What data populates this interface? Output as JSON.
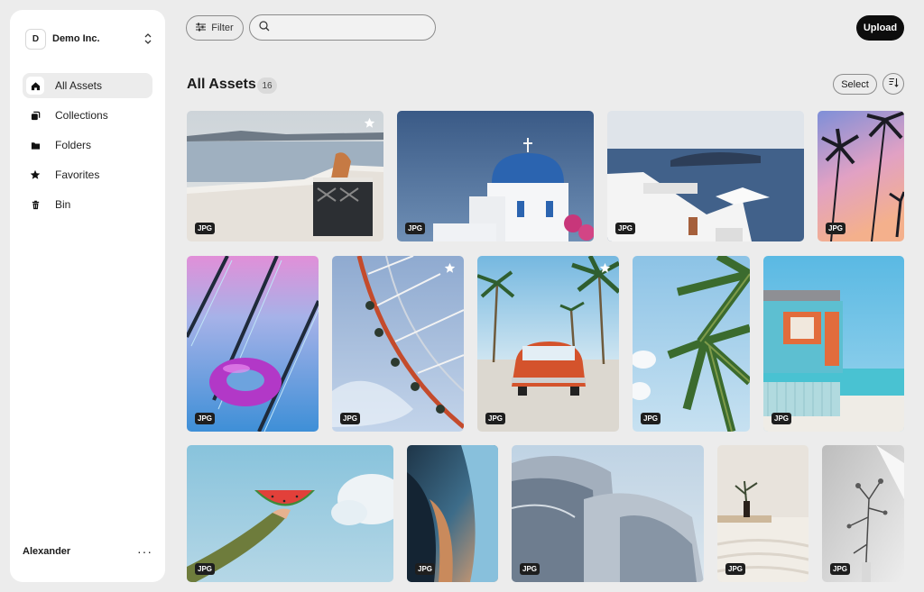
{
  "org": {
    "initial": "D",
    "name": "Demo Inc."
  },
  "nav": {
    "items": [
      {
        "label": "All Assets",
        "icon": "home-icon",
        "active": true
      },
      {
        "label": "Collections",
        "icon": "collections-icon"
      },
      {
        "label": "Folders",
        "icon": "folder-icon"
      },
      {
        "label": "Favorites",
        "icon": "star-icon"
      },
      {
        "label": "Bin",
        "icon": "trash-icon"
      }
    ]
  },
  "user": {
    "name": "Alexander",
    "more": "···"
  },
  "toolbar": {
    "filter_label": "Filter",
    "search_placeholder": "",
    "upload_label": "Upload"
  },
  "header": {
    "title": "All Assets",
    "count": "16",
    "select_label": "Select"
  },
  "assets": [
    {
      "type": "JPG",
      "subject": "santorini-terrace-gate",
      "favorite": true
    },
    {
      "type": "JPG",
      "subject": "blue-dome-church"
    },
    {
      "type": "JPG",
      "subject": "santorini-sea-view"
    },
    {
      "type": "JPG",
      "subject": "palm-trees-pastel-sky"
    },
    {
      "type": "JPG",
      "subject": "pool-float-ring"
    },
    {
      "type": "JPG",
      "subject": "ferris-wheel",
      "favorite": true
    },
    {
      "type": "JPG",
      "subject": "red-vintage-car-palms",
      "favorite": true
    },
    {
      "type": "JPG",
      "subject": "palm-leaves-sky"
    },
    {
      "type": "JPG",
      "subject": "lifeguard-tower"
    },
    {
      "type": "JPG",
      "subject": "hand-watermelon-sky"
    },
    {
      "type": "JPG",
      "subject": "curved-architecture"
    },
    {
      "type": "JPG",
      "subject": "steel-building"
    },
    {
      "type": "JPG",
      "subject": "vase-with-branch"
    },
    {
      "type": "JPG",
      "subject": "dry-flower-shadow"
    }
  ]
}
